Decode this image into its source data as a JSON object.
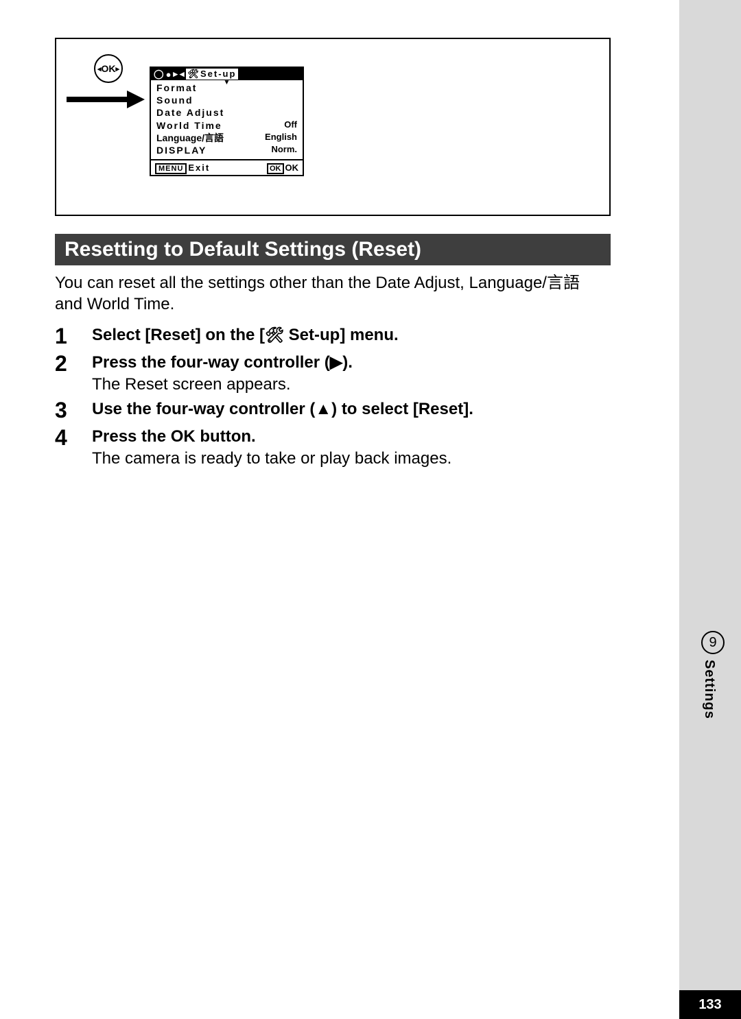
{
  "lcd": {
    "header_title": "Set-up",
    "items": [
      {
        "label": "Format",
        "value": ""
      },
      {
        "label": "Sound",
        "value": ""
      },
      {
        "label": "Date Adjust",
        "value": ""
      },
      {
        "label": "World Time",
        "value": "Off"
      },
      {
        "label": "Language/言語",
        "value": "English"
      },
      {
        "label": "DISPLAY",
        "value": "Norm."
      }
    ],
    "footer_left_box": "MENU",
    "footer_left_text": "Exit",
    "footer_right_box": "OK",
    "footer_right_text": "OK"
  },
  "ok_button": "OK",
  "section_title": "Resetting to Default Settings (Reset)",
  "intro": "You can reset all the settings other than the Date Adjust, Language/言語 and World Time.",
  "steps": [
    {
      "num": "1",
      "bold_pre": "Select [Reset] on the [",
      "icon": "🛠",
      "bold_post": " Set-up] menu.",
      "sub": ""
    },
    {
      "num": "2",
      "bold_pre": "Press the four-way controller (",
      "icon": "▶",
      "bold_post": ").",
      "sub": "The Reset screen appears."
    },
    {
      "num": "3",
      "bold_pre": "Use the four-way controller (",
      "icon": "▲",
      "bold_post": ") to select [Reset].",
      "sub": ""
    },
    {
      "num": "4",
      "bold_pre": "Press the OK button.",
      "icon": "",
      "bold_post": "",
      "sub": "The camera is ready to take or play back images."
    }
  ],
  "side": {
    "chapter_num": "9",
    "chapter_label": "Settings"
  },
  "page_number": "133"
}
